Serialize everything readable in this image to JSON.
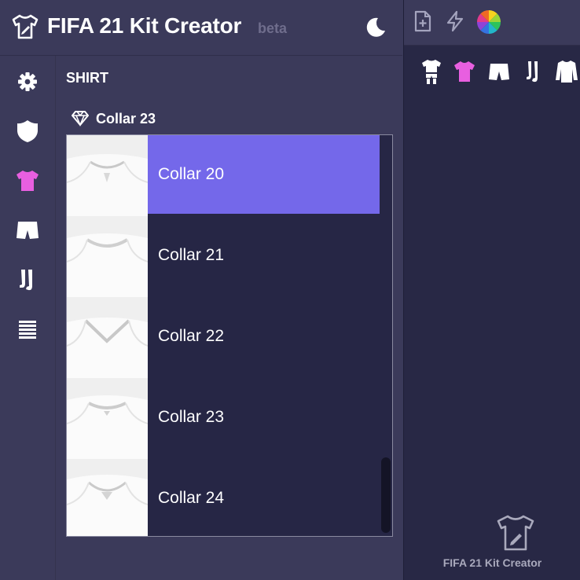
{
  "app": {
    "title": "FIFA 21 Kit Creator",
    "badge": "beta"
  },
  "header": {
    "theme_toggle_icon": "moon-icon"
  },
  "sidebar": {
    "items": [
      {
        "name": "settings",
        "icon": "gear-icon"
      },
      {
        "name": "badge",
        "icon": "shield-icon"
      },
      {
        "name": "shirt",
        "icon": "shirt-icon",
        "active": true
      },
      {
        "name": "shorts",
        "icon": "shorts-icon"
      },
      {
        "name": "socks",
        "icon": "socks-icon"
      },
      {
        "name": "layers",
        "icon": "lines-icon"
      }
    ]
  },
  "section": {
    "title": "SHIRT"
  },
  "collar_select": {
    "selected_label": "Collar 23",
    "options": [
      {
        "label": "Collar 20",
        "highlighted": true
      },
      {
        "label": "Collar 21"
      },
      {
        "label": "Collar 22"
      },
      {
        "label": "Collar 23"
      },
      {
        "label": "Collar 24"
      }
    ]
  },
  "toolbar": {
    "tools": [
      "new-file-icon",
      "lightning-icon",
      "color-wheel-icon"
    ]
  },
  "kit_parts": [
    "full-kit-icon",
    "shirt-icon",
    "shorts-icon",
    "socks-icon",
    "long-sleeve-icon"
  ],
  "footer": {
    "text": "FIFA 21 Kit Creator"
  },
  "colors": {
    "accent_pink": "#e85fe0",
    "highlight": "#7468ea",
    "panel": "#3b3a5a",
    "dark_panel": "#282845"
  }
}
